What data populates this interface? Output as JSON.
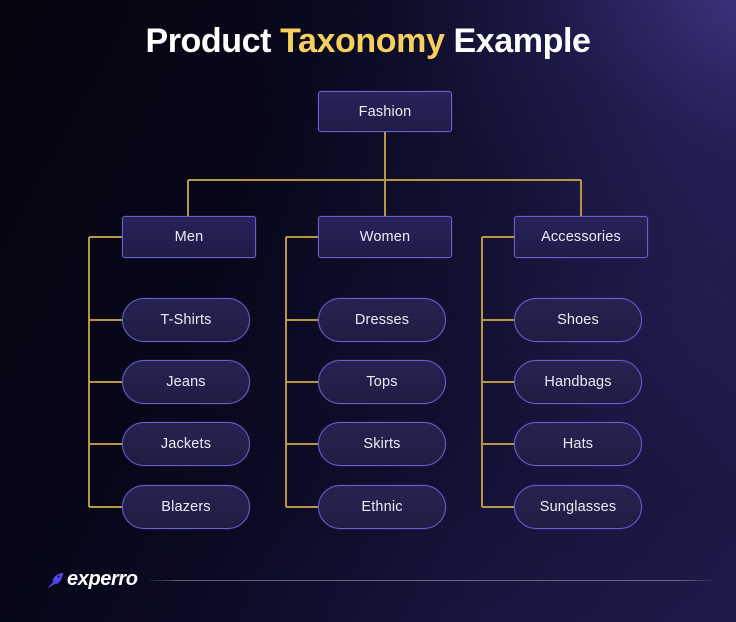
{
  "page": {
    "title_parts": {
      "before": "Product ",
      "accent": "Taxonomy",
      "after": " Example"
    },
    "title_full": "Product Taxonomy Example",
    "background_start": "#05050f",
    "background_end": "#201d52"
  },
  "colors": {
    "node_fill": "#222150",
    "node_border": "#6a5fd0",
    "connector": "#b8963f",
    "accent_gold": "#f7cf5c",
    "text": "#eceaf6",
    "divider": "#b0b0c6"
  },
  "tree": {
    "root": {
      "label": "Fashion"
    },
    "branches": [
      {
        "label": "Men",
        "children": [
          {
            "label": "T-Shirts"
          },
          {
            "label": "Jeans"
          },
          {
            "label": "Jackets"
          },
          {
            "label": "Blazers"
          }
        ]
      },
      {
        "label": "Women",
        "children": [
          {
            "label": "Dresses"
          },
          {
            "label": "Tops"
          },
          {
            "label": "Skirts"
          },
          {
            "label": "Ethnic"
          }
        ]
      },
      {
        "label": "Accessories",
        "children": [
          {
            "label": "Shoes"
          },
          {
            "label": "Handbags"
          },
          {
            "label": "Hats"
          },
          {
            "label": "Sunglasses"
          }
        ]
      }
    ]
  },
  "footer": {
    "logo_text": "experro",
    "logo_mark": "bird-mark-icon"
  }
}
